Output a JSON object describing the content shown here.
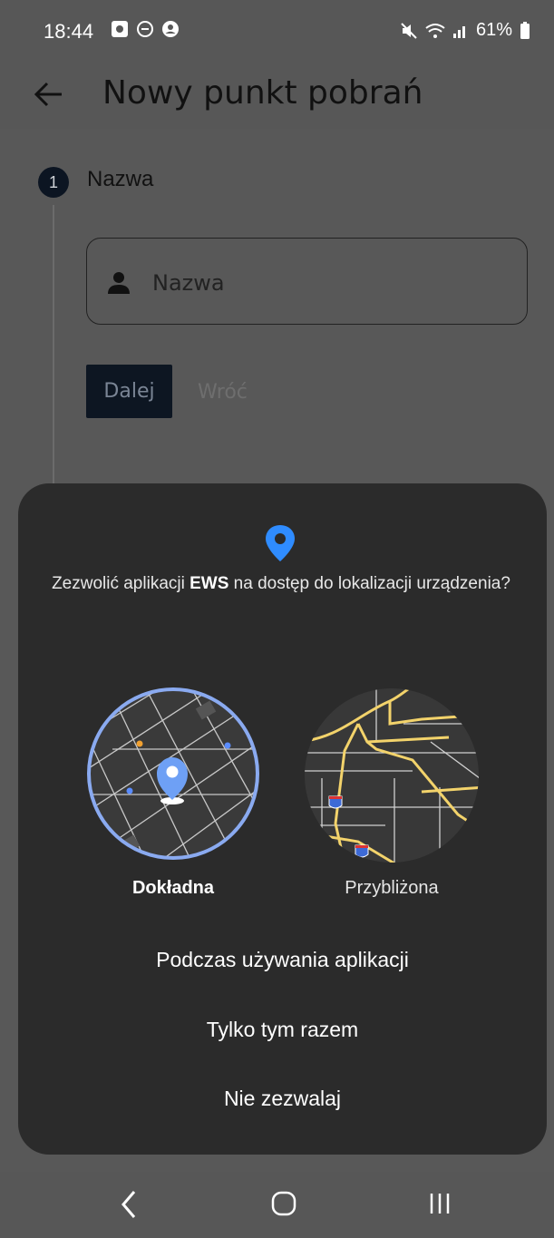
{
  "status_bar": {
    "time": "18:44",
    "battery": "61%",
    "icons_left": [
      "notification-app-icon",
      "do-not-disturb-icon",
      "account-icon"
    ],
    "icons_right": [
      "mute-icon",
      "wifi-icon",
      "signal-icon",
      "battery-icon"
    ]
  },
  "app_bar": {
    "title": "Nowy punkt pobrań"
  },
  "stepper": {
    "step_number": "1",
    "step_label": "Nazwa",
    "name_field": {
      "placeholder": "Nazwa",
      "value": ""
    },
    "next_label": "Dalej",
    "back_label": "Wróć"
  },
  "permission_dialog": {
    "text_prefix": "Zezwolić aplikacji ",
    "app_name": "EWS",
    "text_suffix": " na dostęp do lokalizacji urządzenia?",
    "precise_label": "Dokładna",
    "approximate_label": "Przybliżona",
    "selected_option": "precise",
    "options": [
      "Podczas używania aplikacji",
      "Tylko tym razem",
      "Nie zezwalaj"
    ]
  },
  "colors": {
    "dialog_background": "#2b2b2b",
    "accent_blue": "#2f8cff",
    "scrim": "#575757",
    "road_yellow": "#f3d36b"
  }
}
